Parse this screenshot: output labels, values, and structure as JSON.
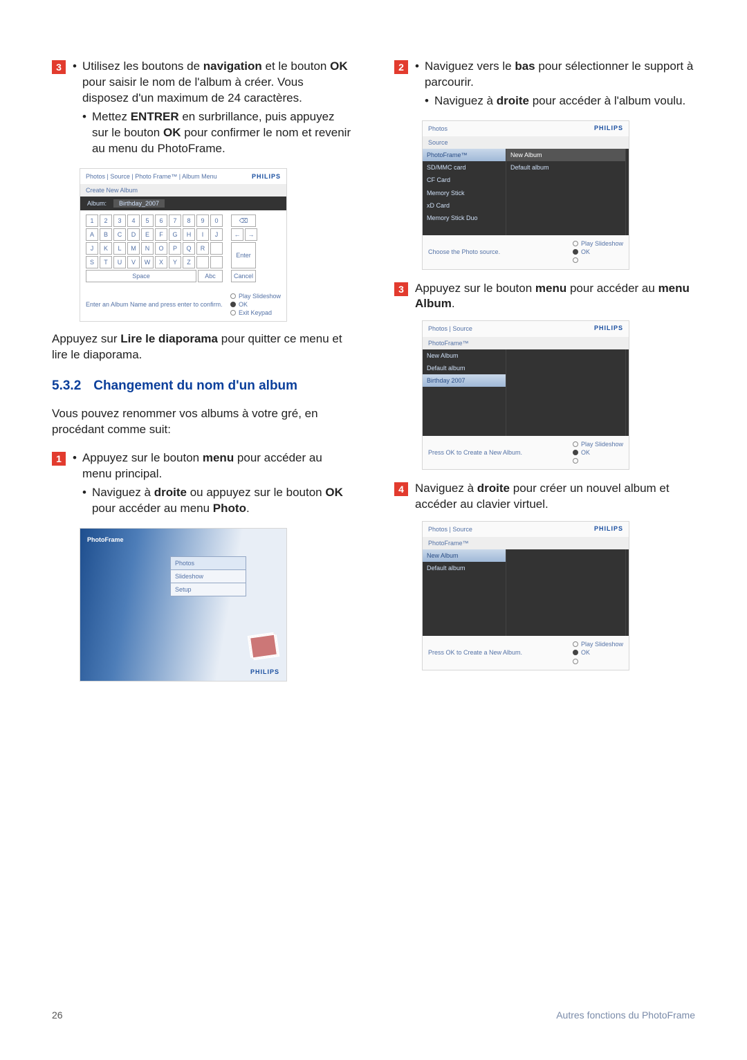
{
  "brand": "PHILIPS",
  "left": {
    "step3": {
      "num": "3",
      "b1_pre": "Utilisez les boutons de ",
      "b1_b1": "navigation",
      "b1_mid": " et le bouton ",
      "b1_b2": "OK",
      "b1_post": " pour saisir le nom de l'album à créer. Vous disposez d'un maximum de 24 caractères.",
      "b2_pre": "Mettez ",
      "b2_b1": "ENTRER",
      "b2_mid": " en surbrillance, puis appuyez sur le bouton ",
      "b2_b2": "OK",
      "b2_post": " pour confirmer le nom et revenir au menu du PhotoFrame."
    },
    "keyboard": {
      "crumbs": "Photos | Source | Photo Frame™ | Album Menu",
      "bar": "Create New Album",
      "album_label": "Album:",
      "album_value": "Birthday_2007",
      "rows": [
        [
          "1",
          "2",
          "3",
          "4",
          "5",
          "6",
          "7",
          "8",
          "9",
          "0"
        ],
        [
          "A",
          "B",
          "C",
          "D",
          "E",
          "F",
          "G",
          "H",
          "I",
          "J"
        ],
        [
          "J",
          "K",
          "L",
          "M",
          "N",
          "O",
          "P",
          "Q",
          "R"
        ],
        [
          "S",
          "T",
          "U",
          "V",
          "W",
          "X",
          "Y",
          "Z"
        ]
      ],
      "space": "Space",
      "abc": "Abc",
      "backspace": "⌫",
      "left": "←",
      "right": "→",
      "enter": "Enter",
      "cancel": "Cancel",
      "hint": "Enter an Album Name and press enter to confirm.",
      "play": "Play Slideshow",
      "ok": "OK",
      "exit": "Exit Keypad"
    },
    "afterKb_pre": "Appuyez sur ",
    "afterKb_b": "Lire le diaporama",
    "afterKb_post": " pour quitter ce menu et lire le diaporama.",
    "section_num": "5.3.2",
    "section_title": "Changement du nom d'un album",
    "section_intro": "Vous pouvez renommer vos albums à votre gré, en procédant comme suit:",
    "step1": {
      "num": "1",
      "b1_pre": "Appuyez sur le bouton ",
      "b1_b1": "menu",
      "b1_post": " pour accéder au menu principal.",
      "b2_pre": "Naviguez à ",
      "b2_b1": "droite",
      "b2_mid": " ou appuyez sur le bouton ",
      "b2_b2": "OK",
      "b2_post": " pour accéder au menu ",
      "b2_b3": "Photo",
      "b2_end": "."
    },
    "pfshot": {
      "title": "PhotoFrame",
      "menu": [
        "Photos",
        "Slideshow",
        "Setup"
      ]
    }
  },
  "right": {
    "step2": {
      "num": "2",
      "b1_pre": "Naviguez vers le ",
      "b1_b1": "bas",
      "b1_post": " pour sélectionner le support à parcourir.",
      "b2_pre": "Naviguez à ",
      "b2_b1": "droite",
      "b2_post": " pour accéder à l'album voulu."
    },
    "shot2": {
      "crumbs": "Photos",
      "bar": "Source",
      "left_items": [
        "PhotoFrame™",
        "SD/MMC card",
        "CF Card",
        "Memory Stick",
        "xD Card",
        "Memory Stick Duo"
      ],
      "mid_items": [
        "New Album",
        "Default album"
      ],
      "hint": "Choose the Photo source.",
      "play": "Play Slideshow",
      "ok": "OK"
    },
    "step3": {
      "num": "3",
      "pre": "Appuyez sur le bouton ",
      "b1": "menu",
      "mid": " pour accéder au ",
      "b2": "menu Album",
      "post": "."
    },
    "shot3": {
      "crumbs": "Photos | Source",
      "bar": "PhotoFrame™",
      "left_items": [
        "New Album",
        "Default album",
        "Birthday 2007"
      ],
      "hint": "Press OK to Create a New Album.",
      "play": "Play Slideshow",
      "ok": "OK"
    },
    "step4": {
      "num": "4",
      "pre": "Naviguez à ",
      "b1": "droite",
      "post": " pour créer un nouvel album et accéder au clavier virtuel."
    },
    "shot4": {
      "crumbs": "Photos | Source",
      "bar": "PhotoFrame™",
      "left_items": [
        "New Album",
        "Default album"
      ],
      "hint": "Press OK to Create a New Album.",
      "play": "Play Slideshow",
      "ok": "OK"
    }
  },
  "footer": {
    "page": "26",
    "label": "Autres fonctions du PhotoFrame"
  }
}
